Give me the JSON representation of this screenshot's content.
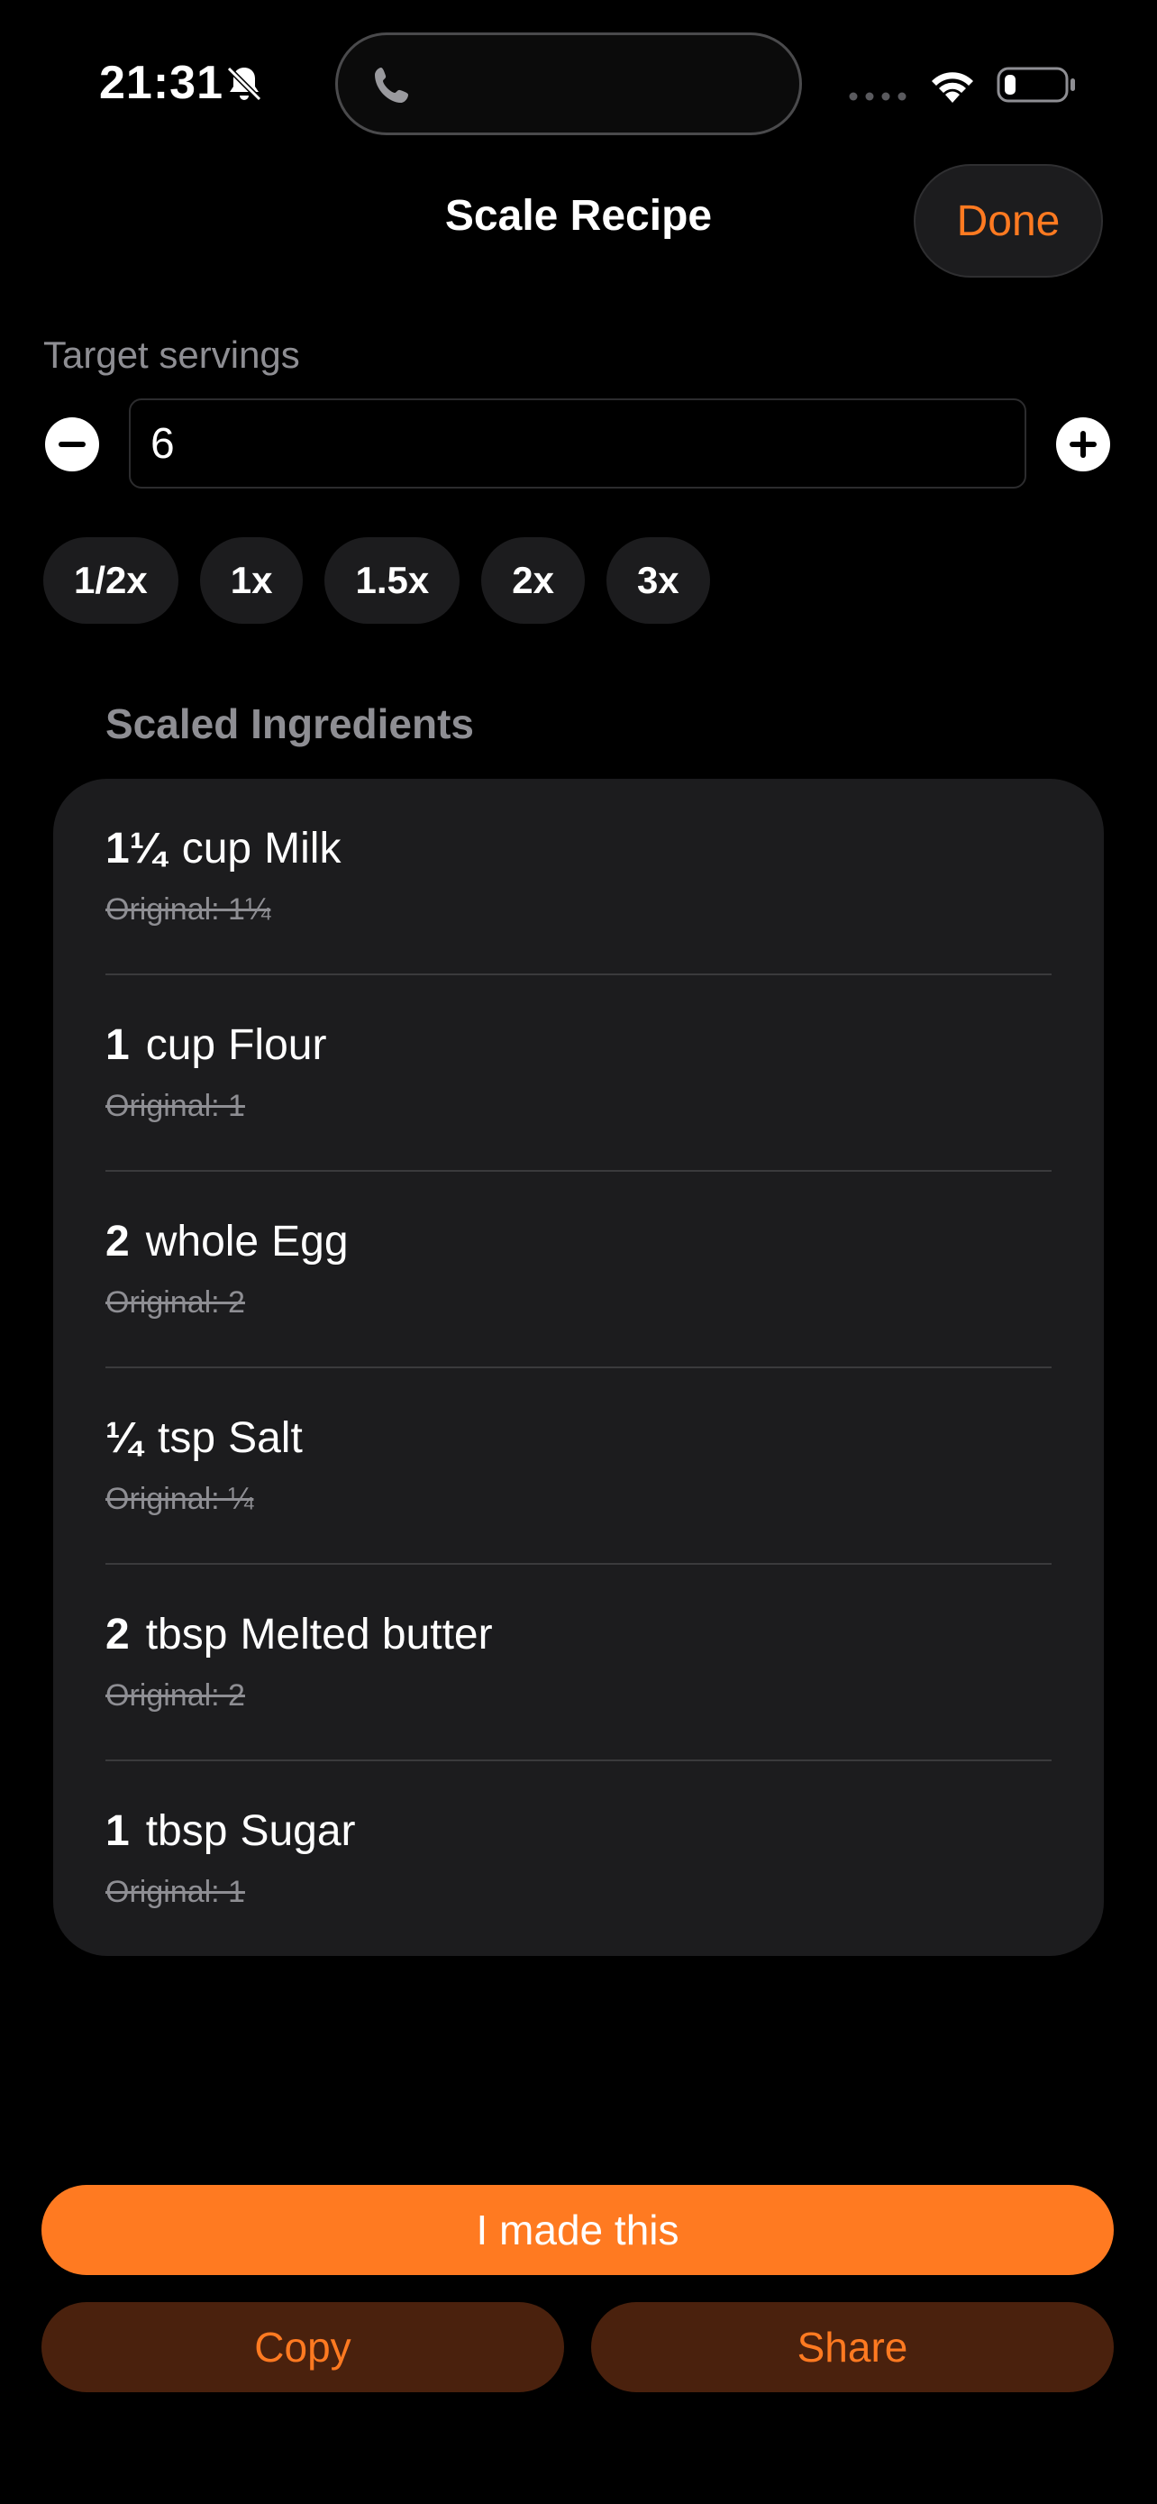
{
  "status_bar": {
    "time": "21:31"
  },
  "nav": {
    "title": "Scale Recipe",
    "done_label": "Done"
  },
  "servings": {
    "label": "Target servings",
    "value": "6"
  },
  "multipliers": [
    "1/2x",
    "1x",
    "1.5x",
    "2x",
    "3x"
  ],
  "ingredients": {
    "header": "Scaled Ingredients",
    "items": [
      {
        "qty": "1¼",
        "unit": "cup",
        "name": "Milk",
        "original": "Original: 1¼"
      },
      {
        "qty": "1",
        "unit": "cup",
        "name": "Flour",
        "original": "Original: 1"
      },
      {
        "qty": "2",
        "unit": "whole",
        "name": "Egg",
        "original": "Original: 2"
      },
      {
        "qty": "¼",
        "unit": "tsp",
        "name": "Salt",
        "original": "Original: ¼"
      },
      {
        "qty": "2",
        "unit": "tbsp",
        "name": "Melted butter",
        "original": "Original: 2"
      },
      {
        "qty": "1",
        "unit": "tbsp",
        "name": "Sugar",
        "original": "Original: 1"
      }
    ]
  },
  "actions": {
    "made_label": "I made this",
    "copy_label": "Copy",
    "share_label": "Share"
  },
  "colors": {
    "accent": "#ff7a21",
    "background": "#000000",
    "card": "#1c1c1e",
    "secondary_text": "#8e8e93",
    "secondary_button": "#4a210d"
  },
  "icons": {
    "bell": "bell-slash-icon",
    "phone": "phone-icon",
    "wifi": "wifi-icon",
    "battery": "battery-icon"
  }
}
